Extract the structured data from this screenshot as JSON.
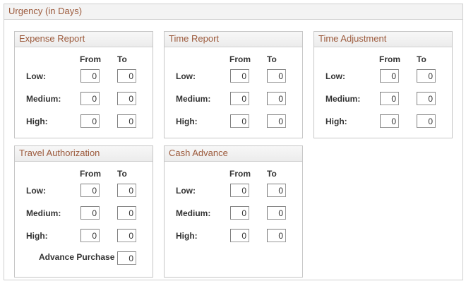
{
  "section": {
    "title": "Urgency (in Days)"
  },
  "column_headers": {
    "from": "From",
    "to": "To"
  },
  "row_labels": {
    "low": "Low:",
    "medium": "Medium:",
    "high": "High:"
  },
  "groups": {
    "expense_report": {
      "title": "Expense Report",
      "low": {
        "from": "0",
        "to": "0"
      },
      "medium": {
        "from": "0",
        "to": "0"
      },
      "high": {
        "from": "0",
        "to": "0"
      }
    },
    "time_report": {
      "title": "Time Report",
      "low": {
        "from": "0",
        "to": "0"
      },
      "medium": {
        "from": "0",
        "to": "0"
      },
      "high": {
        "from": "0",
        "to": "0"
      }
    },
    "time_adjustment": {
      "title": "Time Adjustment",
      "low": {
        "from": "0",
        "to": "0"
      },
      "medium": {
        "from": "0",
        "to": "0"
      },
      "high": {
        "from": "0",
        "to": "0"
      }
    },
    "travel_authorization": {
      "title": "Travel Authorization",
      "low": {
        "from": "0",
        "to": "0"
      },
      "medium": {
        "from": "0",
        "to": "0"
      },
      "high": {
        "from": "0",
        "to": "0"
      },
      "advance_purchase_label": "Advance Purchase",
      "advance_purchase": "0"
    },
    "cash_advance": {
      "title": "Cash Advance",
      "low": {
        "from": "0",
        "to": "0"
      },
      "medium": {
        "from": "0",
        "to": "0"
      },
      "high": {
        "from": "0",
        "to": "0"
      }
    }
  }
}
